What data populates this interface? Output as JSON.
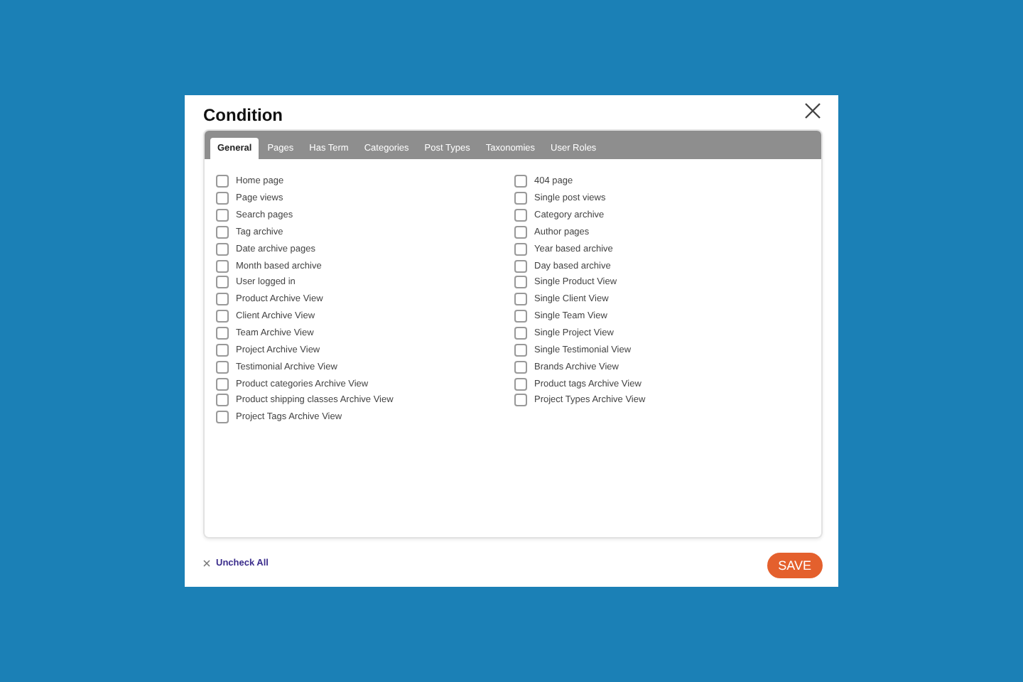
{
  "dialog": {
    "title": "Condition"
  },
  "tabs": [
    {
      "label": "General",
      "selected": true
    },
    {
      "label": "Pages",
      "selected": false
    },
    {
      "label": "Has Term",
      "selected": false
    },
    {
      "label": "Categories",
      "selected": false
    },
    {
      "label": "Post Types",
      "selected": false
    },
    {
      "label": "Taxonomies",
      "selected": false
    },
    {
      "label": "User Roles",
      "selected": false
    }
  ],
  "columns": [
    [
      {
        "label": "Home page",
        "checked": false
      },
      {
        "label": "Page views",
        "checked": false
      },
      {
        "label": "Search pages",
        "checked": false
      },
      {
        "label": "Tag archive",
        "checked": false
      },
      {
        "label": "Date archive pages",
        "checked": false
      },
      {
        "label": "Month based archive",
        "checked": false
      },
      {
        "label": "User logged in",
        "checked": false
      },
      {
        "label": "Product Archive View",
        "checked": false
      },
      {
        "label": "Client Archive View",
        "checked": false
      },
      {
        "label": "Team Archive View",
        "checked": false
      },
      {
        "label": "Project Archive View",
        "checked": false
      },
      {
        "label": "Testimonial Archive View",
        "checked": false
      },
      {
        "label": "Product categories Archive View",
        "checked": false
      },
      {
        "label": "Product shipping classes Archive View",
        "checked": false
      },
      {
        "label": "Project Tags Archive View",
        "checked": false
      }
    ],
    [
      {
        "label": "404 page",
        "checked": false
      },
      {
        "label": "Single post views",
        "checked": false
      },
      {
        "label": "Category archive",
        "checked": false
      },
      {
        "label": "Author pages",
        "checked": false
      },
      {
        "label": "Year based archive",
        "checked": false
      },
      {
        "label": "Day based archive",
        "checked": false
      },
      {
        "label": "Single Product View",
        "checked": false
      },
      {
        "label": "Single Client View",
        "checked": false
      },
      {
        "label": "Single Team View",
        "checked": false
      },
      {
        "label": "Single Project View",
        "checked": false
      },
      {
        "label": "Single Testimonial View",
        "checked": false
      },
      {
        "label": "Brands Archive View",
        "checked": false
      },
      {
        "label": "Product tags Archive View",
        "checked": false
      },
      {
        "label": "Project Types Archive View",
        "checked": false
      }
    ]
  ],
  "footer": {
    "uncheck_all": "Uncheck All",
    "save": "SAVE"
  }
}
